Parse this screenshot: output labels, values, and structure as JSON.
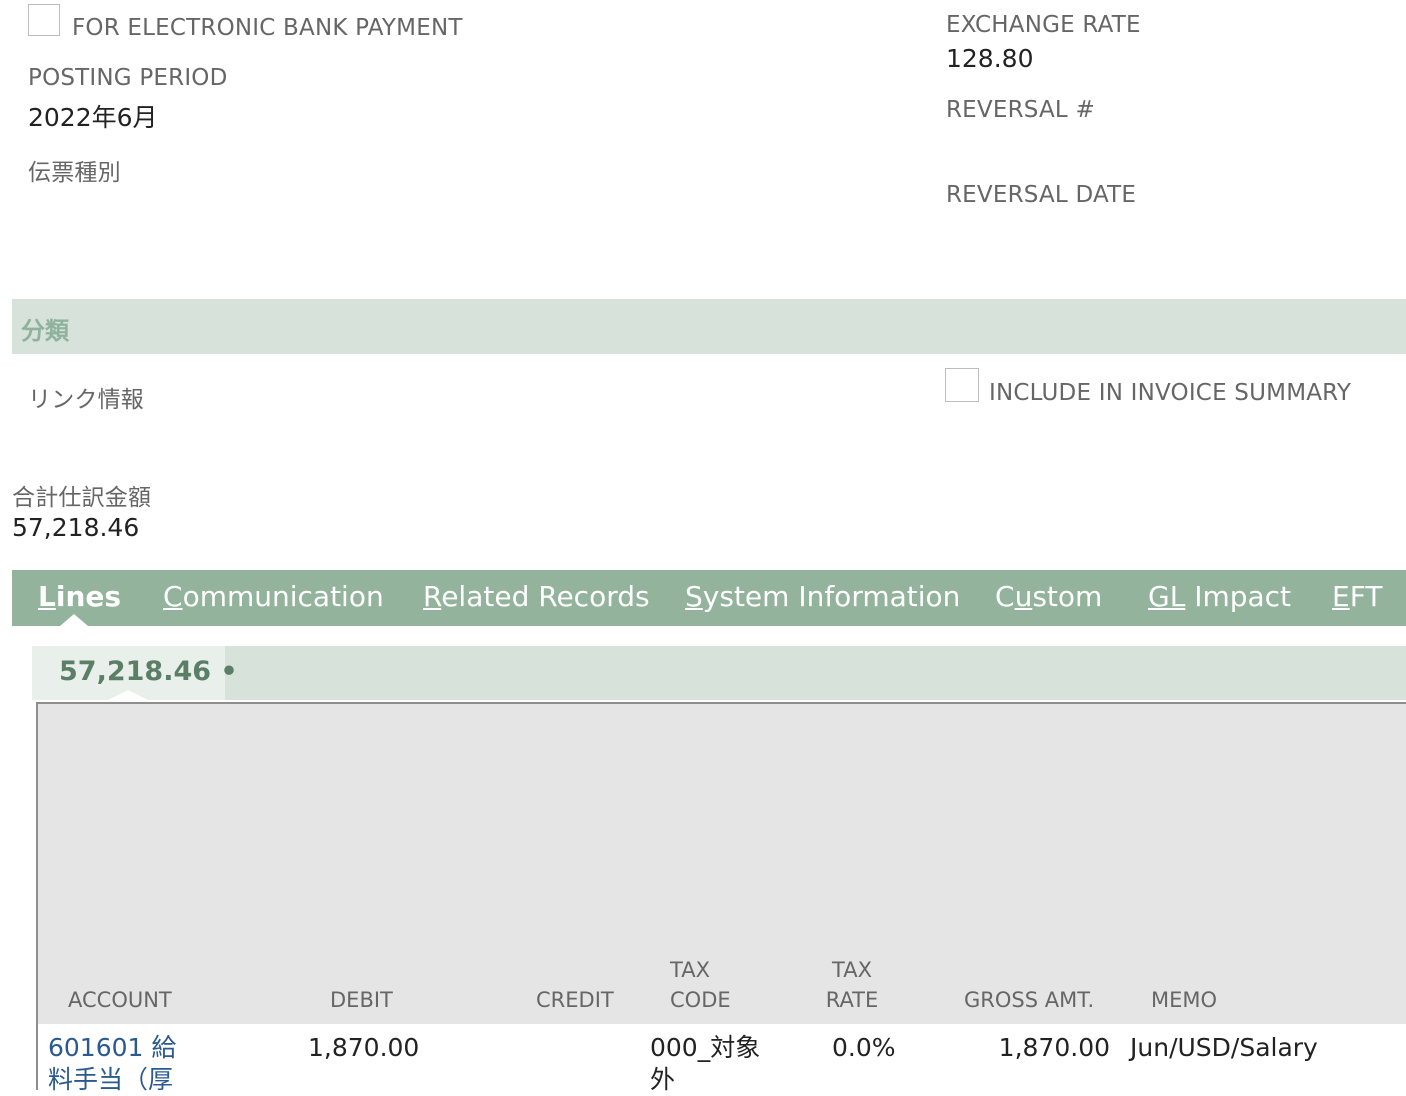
{
  "fields": {
    "electronic_bank_payment_label": "FOR ELECTRONIC BANK PAYMENT",
    "posting_period_label": "POSTING PERIOD",
    "posting_period_value": "2022年6月",
    "voucher_type_label": "伝票種別",
    "exchange_rate_label": "EXCHANGE RATE",
    "exchange_rate_value": "128.80",
    "reversal_no_label": "REVERSAL #",
    "reversal_date_label": "REVERSAL DATE"
  },
  "classification": {
    "section_title": "分類",
    "link_info_label": "リンク情報",
    "include_invoice_summary_label": "INCLUDE IN INVOICE SUMMARY"
  },
  "totals": {
    "total_label": "合計仕訳金額",
    "total_value": "57,218.46"
  },
  "tabs": {
    "lines": {
      "first": "L",
      "rest": "ines"
    },
    "communication": {
      "first": "C",
      "rest": "ommunication"
    },
    "related_records": {
      "first": "R",
      "rest": "elated Records"
    },
    "system_information": {
      "first": "S",
      "rest": "ystem Information"
    },
    "custom": {
      "pre": "C",
      "u": "u",
      "rest": "stom"
    },
    "gl_impact": {
      "first": "GL",
      "rest": " Impact"
    },
    "eft": {
      "first": "E",
      "rest": "FT"
    }
  },
  "subtab": {
    "label": "57,218.46 •"
  },
  "grid": {
    "headers": {
      "account": "ACCOUNT",
      "debit": "DEBIT",
      "credit": "CREDIT",
      "tax_code_1": "TAX",
      "tax_code_2": "CODE",
      "tax_rate_1": "TAX",
      "tax_rate_2": "RATE",
      "gross_amt": "GROSS AMT.",
      "memo": "MEMO"
    },
    "rows": [
      {
        "account_line1": "601601 給",
        "account_line2": "料手当（厚",
        "debit": "1,870.00",
        "credit": "",
        "tax_code_line1": "000_対象",
        "tax_code_line2": "外",
        "tax_rate": "0.0%",
        "gross_amt": "1,870.00",
        "memo": "Jun/USD/Salary"
      }
    ]
  }
}
